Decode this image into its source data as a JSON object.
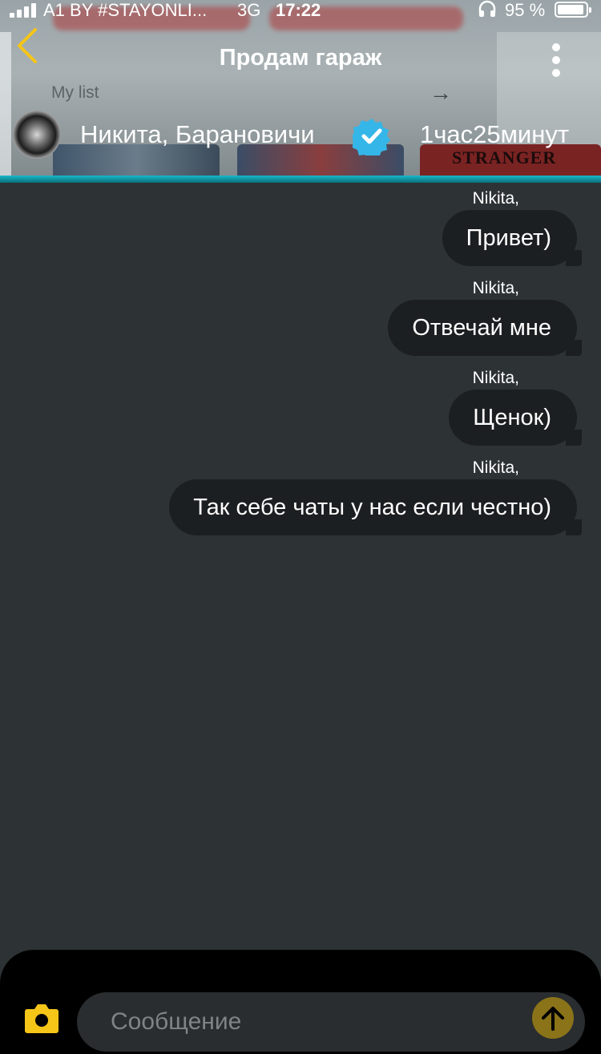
{
  "status_bar": {
    "carrier": "A1 BY #STAYONLI...",
    "network": "3G",
    "time": "17:22",
    "battery": "95 %",
    "battery_level": 0.95
  },
  "background_app": {
    "section_label": "My list",
    "poster_text": "STRANGER"
  },
  "header": {
    "title": "Продам гараж",
    "back_icon": "chevron-left-icon",
    "menu_icon": "more-vertical-icon"
  },
  "contact": {
    "name": "Никита, Барановичи",
    "verified": true,
    "since": "1час25минут"
  },
  "messages": [
    {
      "author": "Nikita,",
      "text": "Привет)"
    },
    {
      "author": "Nikita,",
      "text": "Отвечай мне"
    },
    {
      "author": "Nikita,",
      "text": "Щенок)"
    },
    {
      "author": "Nikita,",
      "text": "Так себе чаты у нас если честно)"
    }
  ],
  "composer": {
    "placeholder": "Сообщение",
    "camera_icon": "camera-icon",
    "send_icon": "send-arrow-up-icon"
  },
  "colors": {
    "accent": "#f5c518",
    "background": "#2d3234",
    "bubble": "#1c1f21",
    "verified": "#35b6e8",
    "send_button": "#8a7319"
  }
}
